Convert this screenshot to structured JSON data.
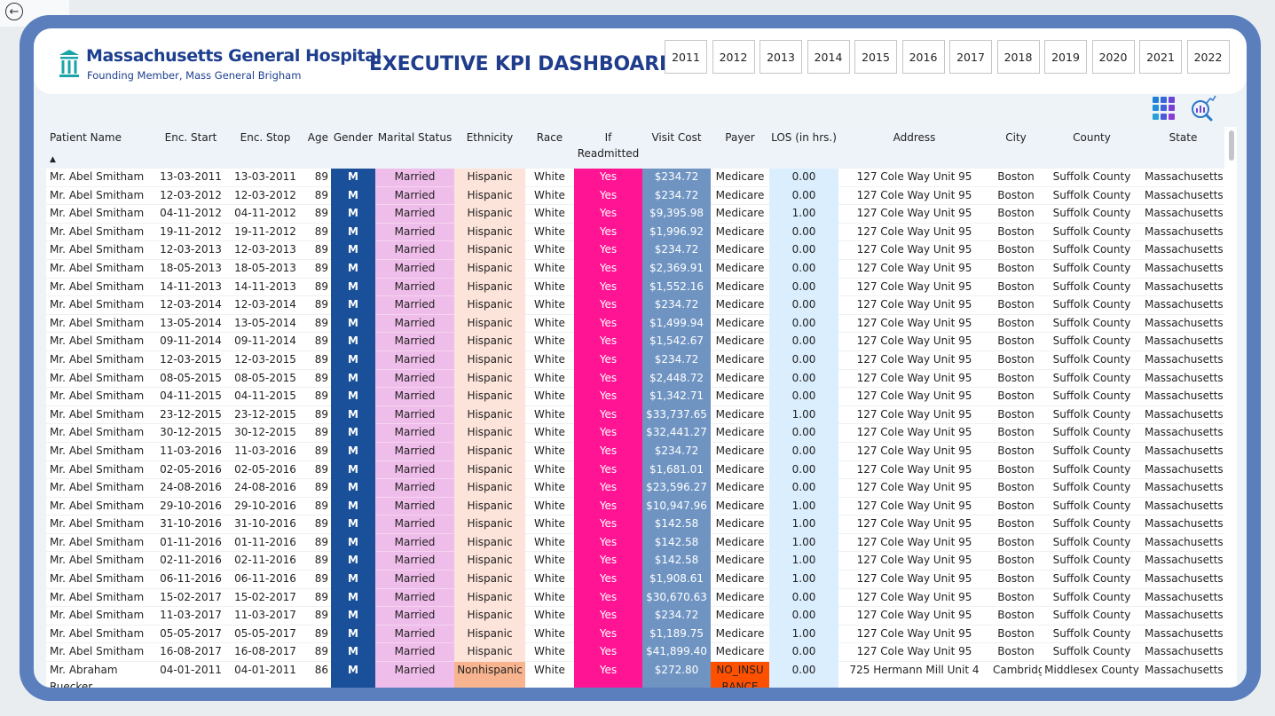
{
  "nav": {
    "back_icon": "←"
  },
  "header": {
    "hospital_name": "Massachusetts General Hospital",
    "hospital_sub": "Founding Member, Mass General Brigham",
    "dashboard_title": "EXECUTIVE KPI DASHBOARD",
    "years": [
      "2011",
      "2012",
      "2013",
      "2014",
      "2015",
      "2016",
      "2017",
      "2018",
      "2019",
      "2020",
      "2021",
      "2022"
    ]
  },
  "icons": {
    "grid": "grid-icon",
    "search": "search-chart-icon"
  },
  "colors": {
    "frame": "#5b7fbd",
    "title": "#1f3d8c",
    "gender": "#1a4f99",
    "marital": "#efbdea",
    "ethnicity": "#fde4da",
    "readmitted": "#ff1493",
    "cost": "#6f94c2",
    "los": "#dbeefe",
    "no_insurance": "#ff5000"
  },
  "table": {
    "columns": [
      "Patient Name",
      "Enc. Start",
      "Enc. Stop",
      "Age",
      "Gender",
      "Marital Status",
      "Ethnicity",
      "Race",
      "If Readmitted",
      "Visit Cost",
      "Payer",
      "LOS (in hrs.)",
      "Address",
      "City",
      "County",
      "State"
    ],
    "sort_indicator": "▲",
    "rows": [
      [
        "Mr. Abel Smitham",
        "13-03-2011",
        "13-03-2011",
        "89",
        "M",
        "Married",
        "Hispanic",
        "White",
        "Yes",
        "$234.72",
        "Medicare",
        "0.00",
        "127 Cole Way Unit 95",
        "Boston",
        "Suffolk County",
        "Massachusetts"
      ],
      [
        "Mr. Abel Smitham",
        "12-03-2012",
        "12-03-2012",
        "89",
        "M",
        "Married",
        "Hispanic",
        "White",
        "Yes",
        "$234.72",
        "Medicare",
        "0.00",
        "127 Cole Way Unit 95",
        "Boston",
        "Suffolk County",
        "Massachusetts"
      ],
      [
        "Mr. Abel Smitham",
        "04-11-2012",
        "04-11-2012",
        "89",
        "M",
        "Married",
        "Hispanic",
        "White",
        "Yes",
        "$9,395.98",
        "Medicare",
        "1.00",
        "127 Cole Way Unit 95",
        "Boston",
        "Suffolk County",
        "Massachusetts"
      ],
      [
        "Mr. Abel Smitham",
        "19-11-2012",
        "19-11-2012",
        "89",
        "M",
        "Married",
        "Hispanic",
        "White",
        "Yes",
        "$1,996.92",
        "Medicare",
        "0.00",
        "127 Cole Way Unit 95",
        "Boston",
        "Suffolk County",
        "Massachusetts"
      ],
      [
        "Mr. Abel Smitham",
        "12-03-2013",
        "12-03-2013",
        "89",
        "M",
        "Married",
        "Hispanic",
        "White",
        "Yes",
        "$234.72",
        "Medicare",
        "0.00",
        "127 Cole Way Unit 95",
        "Boston",
        "Suffolk County",
        "Massachusetts"
      ],
      [
        "Mr. Abel Smitham",
        "18-05-2013",
        "18-05-2013",
        "89",
        "M",
        "Married",
        "Hispanic",
        "White",
        "Yes",
        "$2,369.91",
        "Medicare",
        "0.00",
        "127 Cole Way Unit 95",
        "Boston",
        "Suffolk County",
        "Massachusetts"
      ],
      [
        "Mr. Abel Smitham",
        "14-11-2013",
        "14-11-2013",
        "89",
        "M",
        "Married",
        "Hispanic",
        "White",
        "Yes",
        "$1,552.16",
        "Medicare",
        "0.00",
        "127 Cole Way Unit 95",
        "Boston",
        "Suffolk County",
        "Massachusetts"
      ],
      [
        "Mr. Abel Smitham",
        "12-03-2014",
        "12-03-2014",
        "89",
        "M",
        "Married",
        "Hispanic",
        "White",
        "Yes",
        "$234.72",
        "Medicare",
        "0.00",
        "127 Cole Way Unit 95",
        "Boston",
        "Suffolk County",
        "Massachusetts"
      ],
      [
        "Mr. Abel Smitham",
        "13-05-2014",
        "13-05-2014",
        "89",
        "M",
        "Married",
        "Hispanic",
        "White",
        "Yes",
        "$1,499.94",
        "Medicare",
        "0.00",
        "127 Cole Way Unit 95",
        "Boston",
        "Suffolk County",
        "Massachusetts"
      ],
      [
        "Mr. Abel Smitham",
        "09-11-2014",
        "09-11-2014",
        "89",
        "M",
        "Married",
        "Hispanic",
        "White",
        "Yes",
        "$1,542.67",
        "Medicare",
        "0.00",
        "127 Cole Way Unit 95",
        "Boston",
        "Suffolk County",
        "Massachusetts"
      ],
      [
        "Mr. Abel Smitham",
        "12-03-2015",
        "12-03-2015",
        "89",
        "M",
        "Married",
        "Hispanic",
        "White",
        "Yes",
        "$234.72",
        "Medicare",
        "0.00",
        "127 Cole Way Unit 95",
        "Boston",
        "Suffolk County",
        "Massachusetts"
      ],
      [
        "Mr. Abel Smitham",
        "08-05-2015",
        "08-05-2015",
        "89",
        "M",
        "Married",
        "Hispanic",
        "White",
        "Yes",
        "$2,448.72",
        "Medicare",
        "0.00",
        "127 Cole Way Unit 95",
        "Boston",
        "Suffolk County",
        "Massachusetts"
      ],
      [
        "Mr. Abel Smitham",
        "04-11-2015",
        "04-11-2015",
        "89",
        "M",
        "Married",
        "Hispanic",
        "White",
        "Yes",
        "$1,342.71",
        "Medicare",
        "0.00",
        "127 Cole Way Unit 95",
        "Boston",
        "Suffolk County",
        "Massachusetts"
      ],
      [
        "Mr. Abel Smitham",
        "23-12-2015",
        "23-12-2015",
        "89",
        "M",
        "Married",
        "Hispanic",
        "White",
        "Yes",
        "$33,737.65",
        "Medicare",
        "1.00",
        "127 Cole Way Unit 95",
        "Boston",
        "Suffolk County",
        "Massachusetts"
      ],
      [
        "Mr. Abel Smitham",
        "30-12-2015",
        "30-12-2015",
        "89",
        "M",
        "Married",
        "Hispanic",
        "White",
        "Yes",
        "$32,441.27",
        "Medicare",
        "0.00",
        "127 Cole Way Unit 95",
        "Boston",
        "Suffolk County",
        "Massachusetts"
      ],
      [
        "Mr. Abel Smitham",
        "11-03-2016",
        "11-03-2016",
        "89",
        "M",
        "Married",
        "Hispanic",
        "White",
        "Yes",
        "$234.72",
        "Medicare",
        "0.00",
        "127 Cole Way Unit 95",
        "Boston",
        "Suffolk County",
        "Massachusetts"
      ],
      [
        "Mr. Abel Smitham",
        "02-05-2016",
        "02-05-2016",
        "89",
        "M",
        "Married",
        "Hispanic",
        "White",
        "Yes",
        "$1,681.01",
        "Medicare",
        "0.00",
        "127 Cole Way Unit 95",
        "Boston",
        "Suffolk County",
        "Massachusetts"
      ],
      [
        "Mr. Abel Smitham",
        "24-08-2016",
        "24-08-2016",
        "89",
        "M",
        "Married",
        "Hispanic",
        "White",
        "Yes",
        "$23,596.27",
        "Medicare",
        "0.00",
        "127 Cole Way Unit 95",
        "Boston",
        "Suffolk County",
        "Massachusetts"
      ],
      [
        "Mr. Abel Smitham",
        "29-10-2016",
        "29-10-2016",
        "89",
        "M",
        "Married",
        "Hispanic",
        "White",
        "Yes",
        "$10,947.96",
        "Medicare",
        "1.00",
        "127 Cole Way Unit 95",
        "Boston",
        "Suffolk County",
        "Massachusetts"
      ],
      [
        "Mr. Abel Smitham",
        "31-10-2016",
        "31-10-2016",
        "89",
        "M",
        "Married",
        "Hispanic",
        "White",
        "Yes",
        "$142.58",
        "Medicare",
        "1.00",
        "127 Cole Way Unit 95",
        "Boston",
        "Suffolk County",
        "Massachusetts"
      ],
      [
        "Mr. Abel Smitham",
        "01-11-2016",
        "01-11-2016",
        "89",
        "M",
        "Married",
        "Hispanic",
        "White",
        "Yes",
        "$142.58",
        "Medicare",
        "1.00",
        "127 Cole Way Unit 95",
        "Boston",
        "Suffolk County",
        "Massachusetts"
      ],
      [
        "Mr. Abel Smitham",
        "02-11-2016",
        "02-11-2016",
        "89",
        "M",
        "Married",
        "Hispanic",
        "White",
        "Yes",
        "$142.58",
        "Medicare",
        "1.00",
        "127 Cole Way Unit 95",
        "Boston",
        "Suffolk County",
        "Massachusetts"
      ],
      [
        "Mr. Abel Smitham",
        "06-11-2016",
        "06-11-2016",
        "89",
        "M",
        "Married",
        "Hispanic",
        "White",
        "Yes",
        "$1,908.61",
        "Medicare",
        "1.00",
        "127 Cole Way Unit 95",
        "Boston",
        "Suffolk County",
        "Massachusetts"
      ],
      [
        "Mr. Abel Smitham",
        "15-02-2017",
        "15-02-2017",
        "89",
        "M",
        "Married",
        "Hispanic",
        "White",
        "Yes",
        "$30,670.63",
        "Medicare",
        "0.00",
        "127 Cole Way Unit 95",
        "Boston",
        "Suffolk County",
        "Massachusetts"
      ],
      [
        "Mr. Abel Smitham",
        "11-03-2017",
        "11-03-2017",
        "89",
        "M",
        "Married",
        "Hispanic",
        "White",
        "Yes",
        "$234.72",
        "Medicare",
        "0.00",
        "127 Cole Way Unit 95",
        "Boston",
        "Suffolk County",
        "Massachusetts"
      ],
      [
        "Mr. Abel Smitham",
        "05-05-2017",
        "05-05-2017",
        "89",
        "M",
        "Married",
        "Hispanic",
        "White",
        "Yes",
        "$1,189.75",
        "Medicare",
        "1.00",
        "127 Cole Way Unit 95",
        "Boston",
        "Suffolk County",
        "Massachusetts"
      ],
      [
        "Mr. Abel Smitham",
        "16-08-2017",
        "16-08-2017",
        "89",
        "M",
        "Married",
        "Hispanic",
        "White",
        "Yes",
        "$41,899.40",
        "Medicare",
        "0.00",
        "127 Cole Way Unit 95",
        "Boston",
        "Suffolk County",
        "Massachusetts"
      ],
      [
        "Mr. Abraham Ruecker",
        "04-01-2011",
        "04-01-2011",
        "86",
        "M",
        "Married",
        "Nonhispanic",
        "White",
        "Yes",
        "$272.80",
        "NO_INSURANCE",
        "0.00",
        "725 Hermann Mill Unit 4",
        "Cambridge",
        "Middlesex County",
        "Massachusetts"
      ]
    ]
  }
}
